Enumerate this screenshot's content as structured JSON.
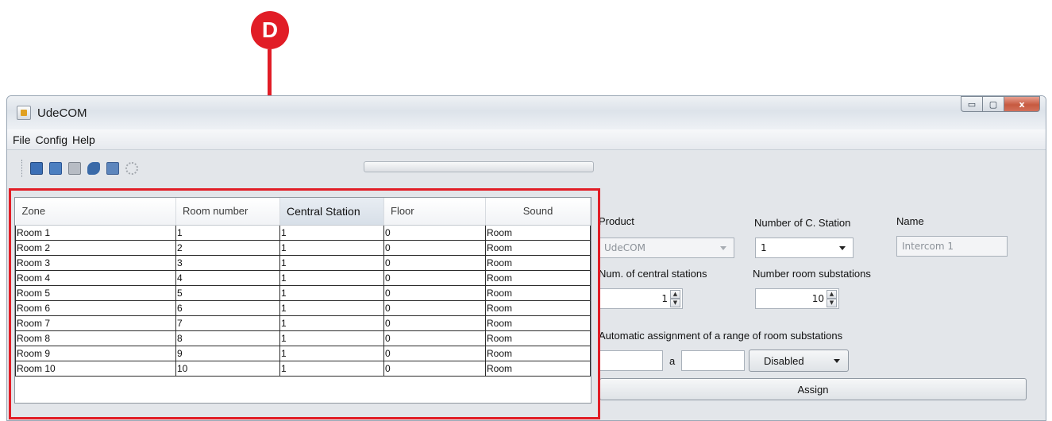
{
  "annotation": {
    "marker": "D"
  },
  "window": {
    "title": "UdeCOM",
    "controls": {
      "minimize": "▭",
      "maximize": "▢",
      "close": "x"
    }
  },
  "menu": [
    "File",
    "Config",
    "Help"
  ],
  "toolbar_icons": [
    "save-icon",
    "save-as-icon",
    "print-icon",
    "transfer-icon",
    "windows-icon",
    "settings-icon"
  ],
  "table": {
    "columns": [
      "Zone",
      "Room number",
      "Central Station",
      "Floor",
      "Sound"
    ],
    "sorted_column": "Central Station",
    "rows": [
      [
        "Room 1",
        "1",
        "1",
        "0",
        "Room"
      ],
      [
        "Room 2",
        "2",
        "1",
        "0",
        "Room"
      ],
      [
        "Room 3",
        "3",
        "1",
        "0",
        "Room"
      ],
      [
        "Room 4",
        "4",
        "1",
        "0",
        "Room"
      ],
      [
        "Room 5",
        "5",
        "1",
        "0",
        "Room"
      ],
      [
        "Room 6",
        "6",
        "1",
        "0",
        "Room"
      ],
      [
        "Room 7",
        "7",
        "1",
        "0",
        "Room"
      ],
      [
        "Room 8",
        "8",
        "1",
        "0",
        "Room"
      ],
      [
        "Room 9",
        "9",
        "1",
        "0",
        "Room"
      ],
      [
        "Room 10",
        "10",
        "1",
        "0",
        "Room"
      ]
    ]
  },
  "panel": {
    "product_label": "Product",
    "product_value": "UdeCOM",
    "num_c_station_label": "Number of C. Station",
    "num_c_station_value": "1",
    "name_label": "Name",
    "name_value": "Intercom 1",
    "num_central_label": "Num. of central stations",
    "num_central_value": "1",
    "num_room_label": "Number room substations",
    "num_room_value": "10",
    "auto_label": "Automatic assignment of a range of room substations",
    "range_from": "",
    "range_sep": "a",
    "range_to": "",
    "mode_value": "Disabled",
    "assign_label": "Assign"
  }
}
